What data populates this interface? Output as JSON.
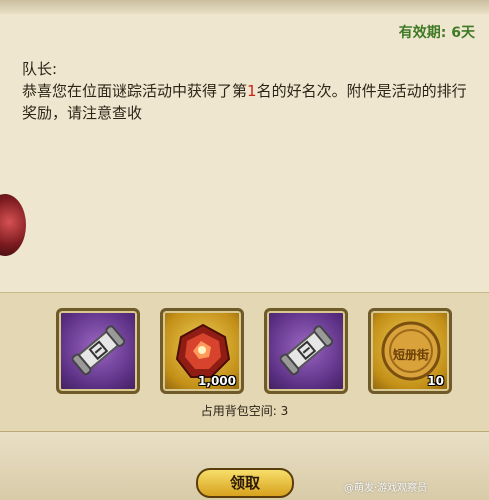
{
  "mail": {
    "validity": "有效期: 6天",
    "greeting": "队长:",
    "message_before": "恭喜您在位面谜踪活动中获得了第",
    "rank": "1",
    "message_after": "名的好名次。附件是活动的排行奖励，请注意查收"
  },
  "rewards": {
    "items": [
      {
        "name": "scroll-item",
        "icon": "scroll-icon",
        "quantity": ""
      },
      {
        "name": "gem-item",
        "icon": "red-gem-icon",
        "quantity": "1,000"
      },
      {
        "name": "scroll-item",
        "icon": "scroll-icon",
        "quantity": ""
      },
      {
        "name": "coin-item",
        "icon": "gold-coin-icon",
        "quantity": "10",
        "coin_text": "短册街"
      }
    ],
    "bag_space": "占用背包空间: 3"
  },
  "actions": {
    "claim_label": "领取"
  },
  "watermark": "@萌发·游戏观察员"
}
